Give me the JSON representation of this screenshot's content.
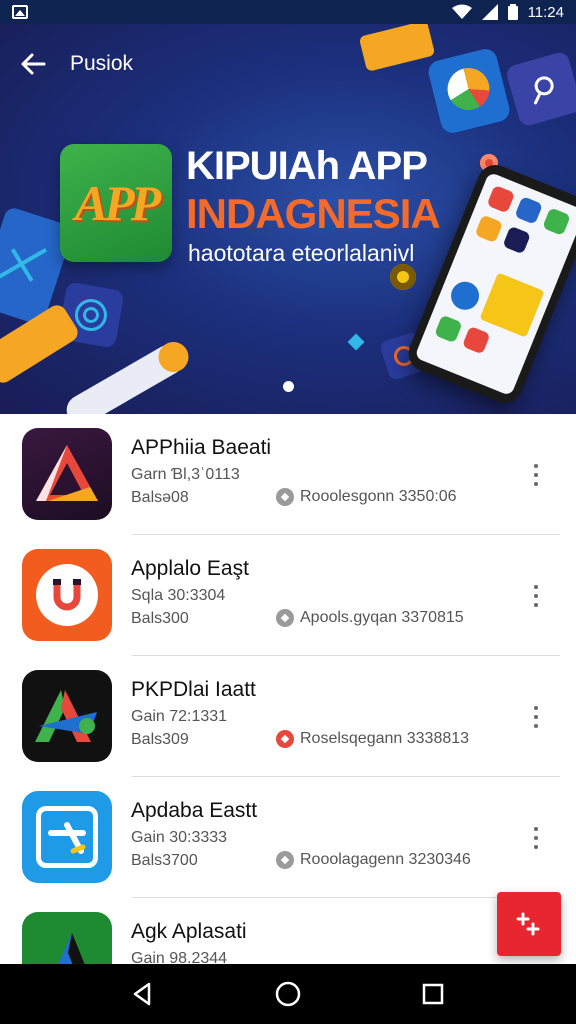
{
  "status_bar": {
    "time": "11:24"
  },
  "header": {
    "title": "Pusiok"
  },
  "banner": {
    "logo_text": "APP",
    "title_line1": "KIPUIAh APP",
    "title_line2": "INDAGNESIA",
    "subtitle": "haototara eteorlalanivl"
  },
  "apps": [
    {
      "name": "APPhiia Baeati",
      "line1": "Garn Ɓl,3ʿ0113",
      "line2": "Balsǝ08",
      "badge_text": "Rooolesgonn 3350:06",
      "badge_color": "#9a9a9a",
      "icon": "triangle-a-icon"
    },
    {
      "name": "Applalo Eaşt",
      "line1": "Sqla 30:3304",
      "line2": "Bals300",
      "badge_text": "Apools.gyqan 3370815",
      "badge_color": "#9a9a9a",
      "icon": "horseshoe-u-icon"
    },
    {
      "name": "PKPDlai Iaatt",
      "line1": "Gain 72:1331",
      "line2": "Bals309",
      "badge_text": "Roselsqegann 3338813",
      "badge_color": "#e8483b",
      "icon": "colorful-a-icon"
    },
    {
      "name": "Apdaba Eastt",
      "line1": "Gain 30:3333",
      "line2": "Bals3700",
      "badge_text": "Rooolagagenn 3230346",
      "badge_color": "#9a9a9a",
      "icon": "square-x-icon"
    },
    {
      "name": "Agk Aplasati",
      "line1": "Gain 98.2344",
      "line2": "",
      "badge_text": "",
      "badge_color": "#9a9a9a",
      "icon": "green-a-icon"
    }
  ],
  "colors": {
    "accent": "#e8262f",
    "banner_bg": "#1b2f7c",
    "title_orange": "#f26b2b"
  }
}
